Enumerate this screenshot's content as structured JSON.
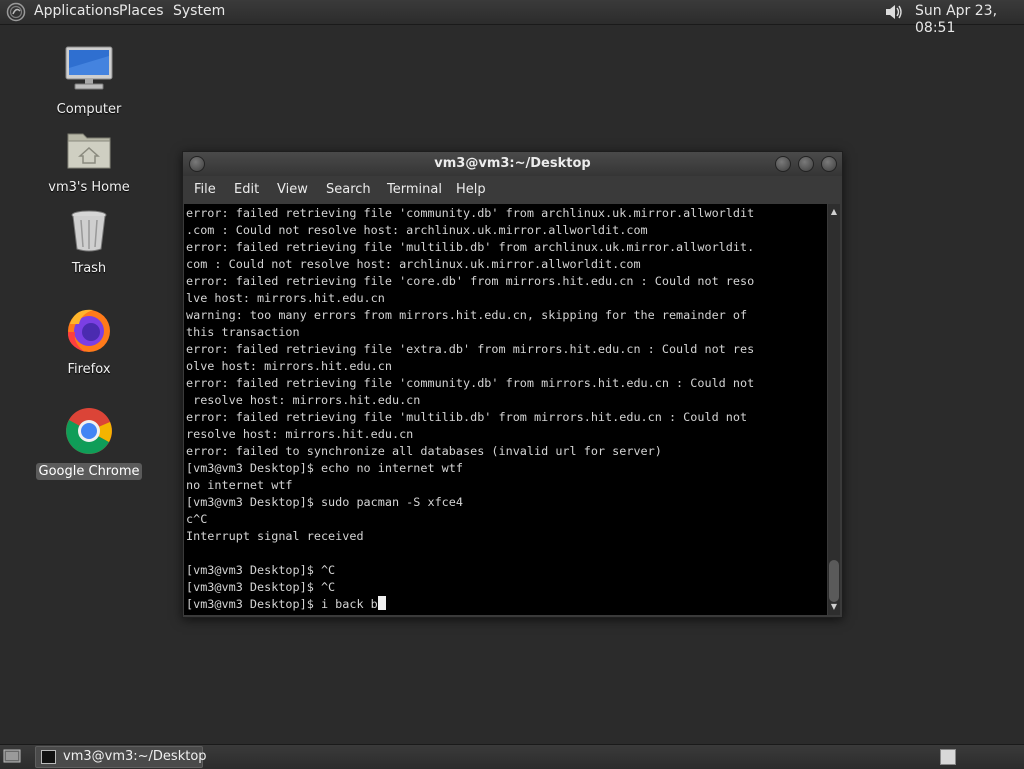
{
  "top_panel": {
    "menus": [
      "Applications",
      "Places",
      "System"
    ],
    "clock": "Sun Apr 23, 08:51",
    "icons": {
      "logo": "gnome-foot-icon",
      "volume": "volume-icon"
    }
  },
  "desktop": {
    "icons": [
      {
        "label": "Computer",
        "icon": "computer-monitor-icon"
      },
      {
        "label": "vm3's Home",
        "icon": "home-folder-icon"
      },
      {
        "label": "Trash",
        "icon": "trash-can-icon"
      },
      {
        "label": "Firefox",
        "icon": "firefox-icon"
      },
      {
        "label": "Google Chrome",
        "icon": "chrome-icon",
        "selected": true
      }
    ]
  },
  "terminal": {
    "title": "vm3@vm3:~/Desktop",
    "menu": [
      "File",
      "Edit",
      "View",
      "Search",
      "Terminal",
      "Help"
    ],
    "lines": [
      "error: failed retrieving file 'community.db' from archlinux.uk.mirror.allworldit",
      ".com : Could not resolve host: archlinux.uk.mirror.allworldit.com",
      "error: failed retrieving file 'multilib.db' from archlinux.uk.mirror.allworldit.",
      "com : Could not resolve host: archlinux.uk.mirror.allworldit.com",
      "error: failed retrieving file 'core.db' from mirrors.hit.edu.cn : Could not reso",
      "lve host: mirrors.hit.edu.cn",
      "warning: too many errors from mirrors.hit.edu.cn, skipping for the remainder of",
      "this transaction",
      "error: failed retrieving file 'extra.db' from mirrors.hit.edu.cn : Could not res",
      "olve host: mirrors.hit.edu.cn",
      "error: failed retrieving file 'community.db' from mirrors.hit.edu.cn : Could not",
      " resolve host: mirrors.hit.edu.cn",
      "error: failed retrieving file 'multilib.db' from mirrors.hit.edu.cn : Could not",
      "resolve host: mirrors.hit.edu.cn",
      "error: failed to synchronize all databases (invalid url for server)",
      "[vm3@vm3 Desktop]$ echo no internet wtf",
      "no internet wtf",
      "[vm3@vm3 Desktop]$ sudo pacman -S xfce4",
      "c^C",
      "Interrupt signal received",
      "",
      "[vm3@vm3 Desktop]$ ^C",
      "[vm3@vm3 Desktop]$ ^C",
      "[vm3@vm3 Desktop]$ i back b"
    ]
  },
  "bottom_panel": {
    "task_label": "vm3@vm3:~/Desktop",
    "icons": {
      "show_desktop": "show-desktop-icon",
      "task": "terminal-icon",
      "workspace": "workspace-switcher-icon"
    }
  }
}
